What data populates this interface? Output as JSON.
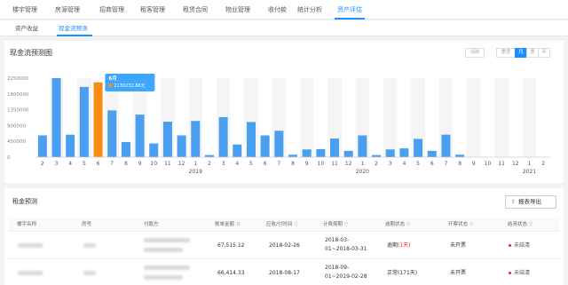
{
  "top_nav": {
    "items": [
      "楼宇管理",
      "房源管理",
      "招商管理",
      "租客管理",
      "租赁合同",
      "物业管理",
      "收付款",
      "统计分析",
      "资产评估"
    ],
    "active_index": 8
  },
  "sub_nav": {
    "items": [
      "资产收益",
      "现金流预测"
    ],
    "active_index": 1
  },
  "chart_card": {
    "title": "现金流预测图",
    "clear_label": "清除",
    "period_options": [
      "季度",
      "月",
      "季",
      "年"
    ],
    "active_period": 1
  },
  "chart_data": {
    "type": "bar",
    "x": [
      "2",
      "3",
      "4",
      "5",
      "6",
      "7",
      "8",
      "9",
      "10",
      "11",
      "12",
      "1",
      "2",
      "3",
      "4",
      "5",
      "6",
      "7",
      "8",
      "9",
      "10",
      "11",
      "12",
      "1",
      "2",
      "3",
      "4",
      "5",
      "6",
      "7",
      "8",
      "9",
      "10",
      "11",
      "12",
      "1",
      "2"
    ],
    "values": [
      620000,
      2250000,
      640000,
      2000000,
      2130232.88,
      1330000,
      430000,
      1210000,
      390000,
      1010000,
      620000,
      1030000,
      60000,
      1140000,
      360000,
      1000000,
      620000,
      750000,
      70000,
      220000,
      230000,
      530000,
      180000,
      620000,
      60000,
      220000,
      250000,
      520000,
      180000,
      640000,
      70000,
      0,
      0,
      0,
      0,
      0,
      0
    ],
    "year_labels": [
      "2019",
      "2020",
      "2021"
    ],
    "year_positions": [
      11,
      23,
      35
    ],
    "yticks": [
      "2250000",
      "1800000",
      "1350000",
      "900000",
      "450000",
      "0"
    ],
    "ylim": [
      0,
      2250000
    ],
    "highlight_index": 4,
    "tooltip_title": "6月",
    "tooltip_value": "2130232.88元",
    "colors": {
      "bar": "#4b9ff0",
      "highlight": "#fa8c16",
      "stripe": "#f5f5f5",
      "tooltip_bg": "#3da6ff"
    }
  },
  "table_card": {
    "title": "租金预测",
    "export_label": "报表导出",
    "columns": [
      "楼宇名称",
      "房号",
      "付款方",
      "账单金额",
      "应收/付时间",
      "计费周期",
      "逾期状态",
      "开票状态",
      "结清状态"
    ],
    "rows": [
      {
        "amount": "67,515.12",
        "due_date": "2018-02-26",
        "period_a": "2018-03-",
        "period_b": "01~2018-03-31",
        "overdue_a": "逾期",
        "overdue_b": "(1天)",
        "invoice": "未开票",
        "settle": "未结清"
      },
      {
        "amount": "66,414.33",
        "due_date": "2018-08-17",
        "period_a": "2018-09-",
        "period_b": "01~2019-02-28",
        "overdue_a": "正常(171天)",
        "overdue_b": "",
        "invoice": "未开票",
        "settle": "未结清"
      }
    ]
  }
}
